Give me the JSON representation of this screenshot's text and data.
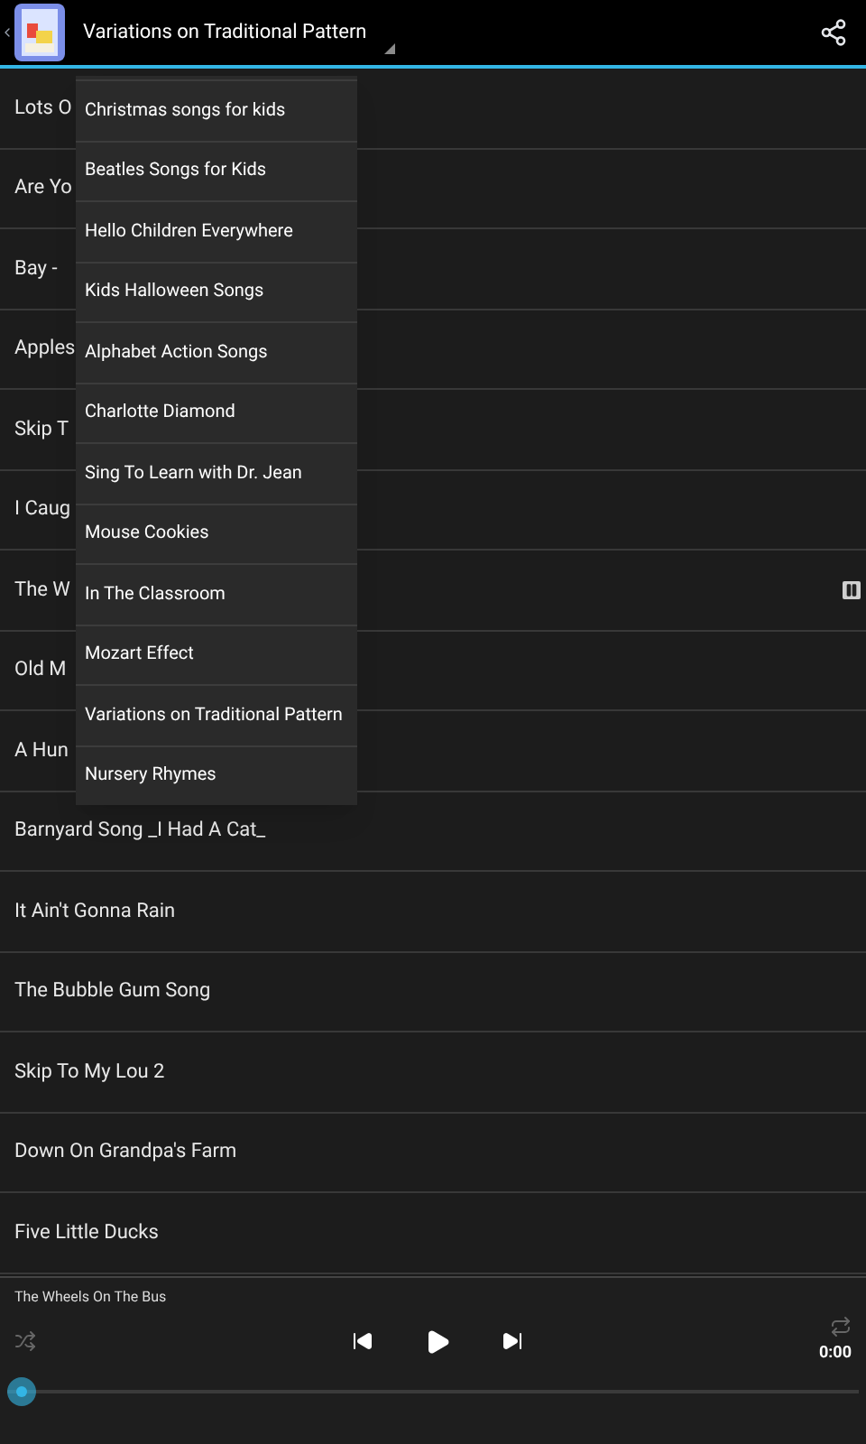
{
  "header": {
    "title": "Variations on Traditional Pattern"
  },
  "songs": [
    {
      "title": "Lots O",
      "playing": false
    },
    {
      "title": "Are Yo",
      "playing": false
    },
    {
      "title": "Bay -",
      "playing": false
    },
    {
      "title": "Apples",
      "playing": false
    },
    {
      "title": "Skip T",
      "playing": false
    },
    {
      "title": "I Caug",
      "playing": false
    },
    {
      "title": "The W",
      "playing": true
    },
    {
      "title": "Old M",
      "playing": false
    },
    {
      "title": "A Hun",
      "playing": false
    },
    {
      "title": "Barnyard Song _I Had A Cat_",
      "playing": false
    },
    {
      "title": "It Ain't Gonna Rain",
      "playing": false
    },
    {
      "title": "The Bubble Gum Song",
      "playing": false
    },
    {
      "title": "Skip To My Lou 2",
      "playing": false
    },
    {
      "title": "Down On Grandpa's Farm",
      "playing": false
    },
    {
      "title": "Five Little Ducks",
      "playing": false
    }
  ],
  "dropdown": {
    "items": [
      {
        "label": "Christmas songs for kids",
        "selected": false
      },
      {
        "label": "Beatles Songs for Kids",
        "selected": false
      },
      {
        "label": "Hello Children Everywhere",
        "selected": false
      },
      {
        "label": "Kids Halloween Songs",
        "selected": false
      },
      {
        "label": "Alphabet Action Songs",
        "selected": false
      },
      {
        "label": "Charlotte Diamond",
        "selected": false
      },
      {
        "label": "Sing To Learn with Dr. Jean",
        "selected": false
      },
      {
        "label": "Mouse Cookies",
        "selected": false
      },
      {
        "label": "In The Classroom",
        "selected": false
      },
      {
        "label": "Mozart Effect",
        "selected": false
      },
      {
        "label": "Variations on Traditional Pattern",
        "selected": false
      },
      {
        "label": "Nursery Rhymes",
        "selected": false
      }
    ]
  },
  "player": {
    "now_playing": "The Wheels On The Bus",
    "time": "0:00"
  }
}
